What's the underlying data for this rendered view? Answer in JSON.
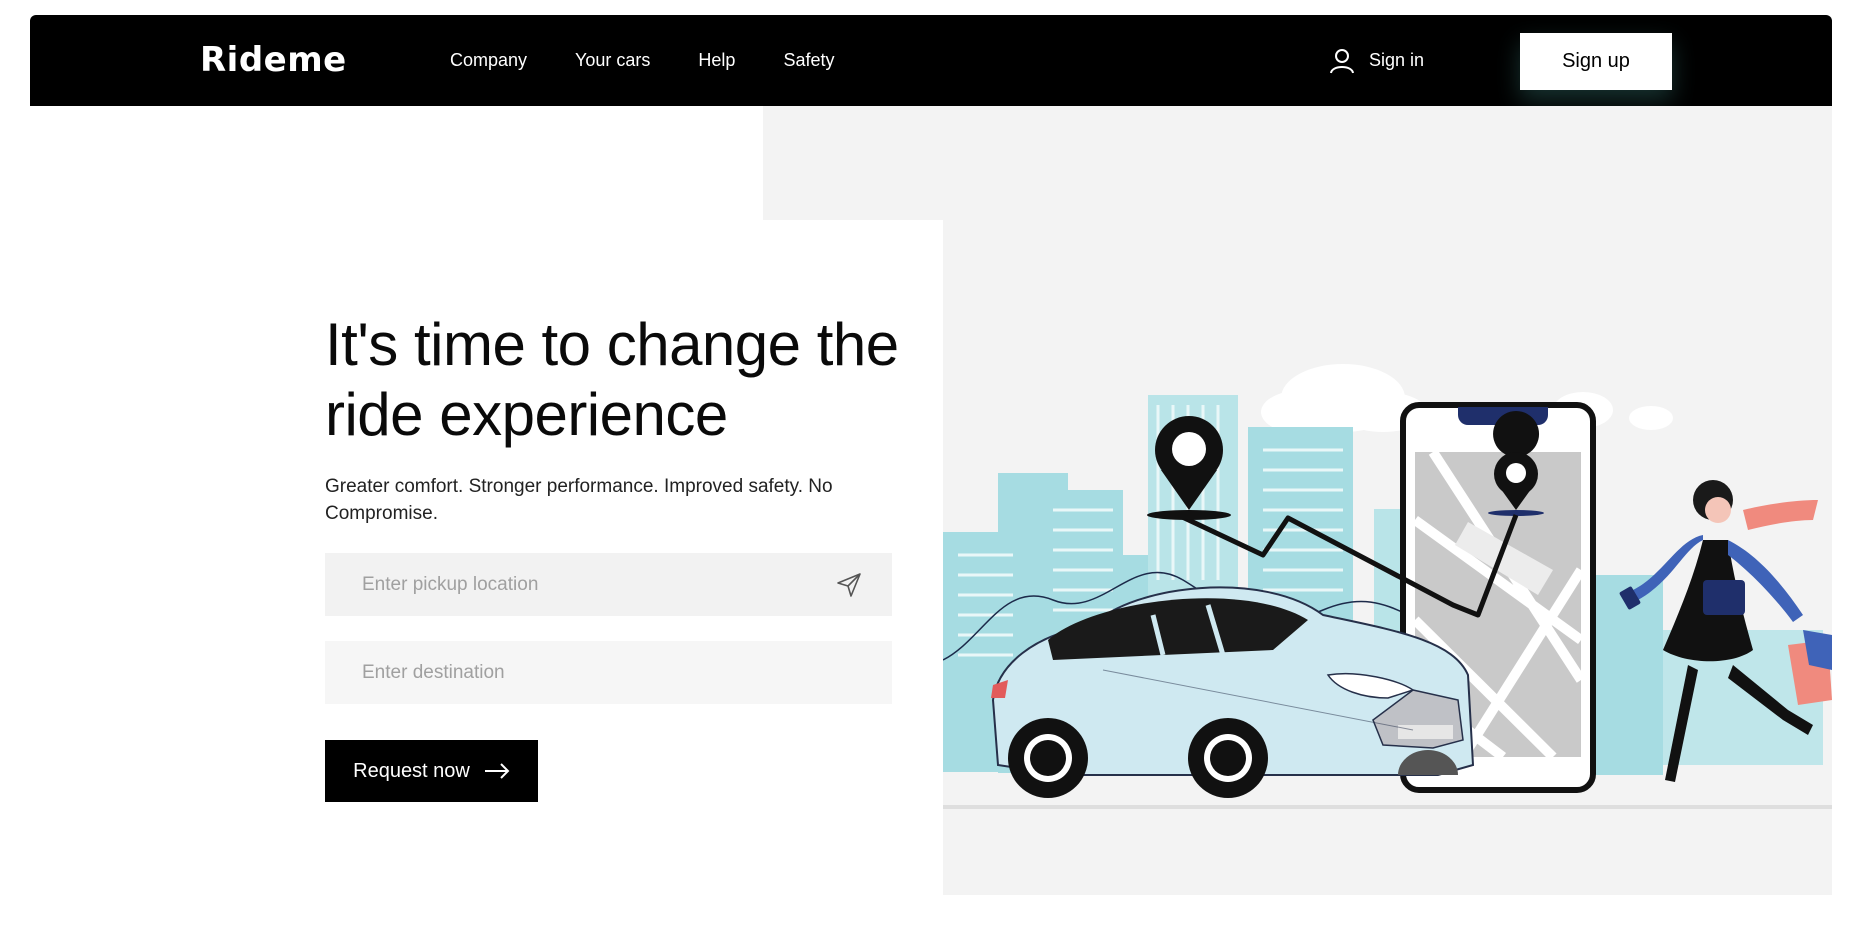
{
  "brand": {
    "name": "Rideme"
  },
  "nav": {
    "links": [
      {
        "label": "Company"
      },
      {
        "label": "Your cars"
      },
      {
        "label": "Help"
      },
      {
        "label": "Safety"
      }
    ],
    "signin_label": "Sign in",
    "signup_label": "Sign up"
  },
  "hero": {
    "headline": "It's time to change the ride experience",
    "subtitle": "Greater comfort. Stronger performance. Improved safety. No Compromise.",
    "pickup_placeholder": "Enter pickup location",
    "pickup_value": "",
    "destination_placeholder": "Enter destination",
    "destination_value": "",
    "request_label": "Request now"
  },
  "icons": {
    "user": "user-icon",
    "send": "send-location-icon",
    "arrow": "arrow-right-icon"
  },
  "colors": {
    "nav_bg": "#000000",
    "accent_cyan": "#9dd6dd",
    "panel_gray": "#f3f3f3",
    "car_body": "#cfe9f1",
    "scarf": "#f08a7e",
    "jacket": "#3f63b8"
  }
}
